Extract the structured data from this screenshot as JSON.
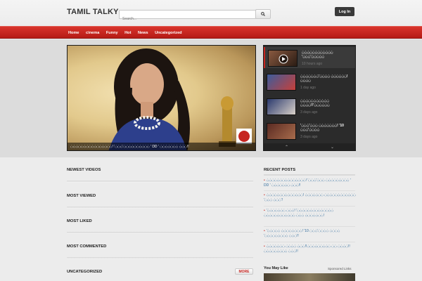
{
  "header": {
    "logo": "TAMIL TALKY",
    "search_placeholder": "Search...",
    "login_label": "Log In"
  },
  "nav": {
    "items": [
      "Home",
      "cinema",
      "Funny",
      "Hot",
      "News",
      "Uncategorized"
    ]
  },
  "featured": {
    "caption": "ப்ப்ப்ப்ப்ப்ப்ப்ப்ப்ப்ப்ப்ப்ப்ப்! 'ப்ப்ப்'ப்ப்ப்ப்ப்ப்ப்ப்ப்ப் ' DD ' ப்ப்ப்ப்ப்ப்ப் ப்ப்ப்!!",
    "side_items": [
      {
        "title": "ப்ப்ப்ப்ப்ப்ப்ப்ப்ப்ப்ப் 'ப்ப்ப்'ப்ப்ப்ப்ப்",
        "time": "10 hours ago"
      },
      {
        "title": "ப்ப்ப்ப்ப்ப்ப்'ப்ப்ப்ப் ப்ப்ப்ப்ப்ப்! ப்ப்ப்ப்",
        "time": "1 day ago"
      },
      {
        "title": "ப்ப்ப்ப்ப்ப்ப்ப்ப்ப்ப் ப்ப்ப்ப்!!'ப்ப்ப்ப்ப்ப்",
        "time": "3 days ago"
      },
      {
        "title": "'ப்ப்ப்'ப்ப்ப் ப்ப்ப்ப்ப்ப்ப்! '10 ப்ப்ப்'ப்ப்ப்ப்",
        "time": "3 days ago"
      }
    ]
  },
  "sections": {
    "newest": "NEWEST VIDEOS",
    "viewed": "MOST VIEWED",
    "liked": "MOST LIKED",
    "commented": "MOST COMMENTED",
    "uncategorized": "UNCATEGORIZED",
    "more_label": "MORE"
  },
  "recent": {
    "title": "RECENT POSTS",
    "items": [
      "ப்ப்ப்ப்ப்ப்ப்ப்ப்ப்ப்ப்ப்ப்ப்! 'ப்ப்ப்'ப்ப்ப் ப்ப்ப்ப்ப்ப்ப்ப்ப் ' DD ' ப்ப்ப்ப்ப்ப்ப் ப்ப்ப்!!",
      "ப்ப்ப்ப்ப்ப்ப்ப்ப்ப்ப்ப்ப்ப்! ப்ப்ப்ப்ப்ப்ப் ப்ப்ப்ப்ப்ப்ப்ப்ப்ப்ப்ப் 'ப்ப்ப் ப்ப்ப்'!",
      "'ப்ப்ப்ப்ப்ப்ப் ப்ப்ப்! 'ப்ப்ப்ப்ப்ப்ப்ப்ப்ப்ப்ப்ப்ப் ப்ப்ப்ப்ப்ப்ப்ப்ப்ப்ப்ப் ப்ப்ப் ப்ப்ப்ப்ப்ப்ப்!",
      "'ப்ப்ப்ப்ப் ப்ப்ப்ப்ப்ப்ப்ப்! '10 ப்ப்ப்'ப்ப்ப்ப் ப்ப்ப்ப் 'ப்ப்ப்ப்ப்ப்ப்ப்ப் ப்ப்ப்!!",
      "ப்ப்ப்ப்ப்ப்ப் ப்ப்ப்ப் ப்ப்ப்!!ப்ப்ப்ப்ப்ப்ப்ப்ப் ப்ப் ப்ப்ப்ப்!!ப்ப்ப்ப்ப்ப்ப்ப்ப் ப்ப்ப்!!"
    ]
  },
  "maylike": {
    "title": "You May Like",
    "sponsored": "Sponsored Links"
  },
  "colors": {
    "accent": "#c62520",
    "link": "#2d6a9c"
  }
}
